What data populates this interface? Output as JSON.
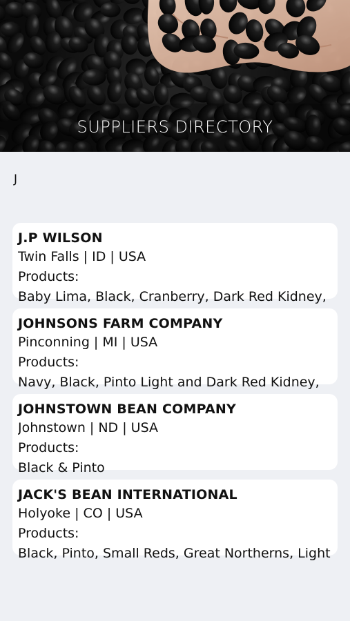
{
  "header": {
    "title": "SUPPLIERS DIRECTORY"
  },
  "filter_letter": "J",
  "suppliers": [
    {
      "name": "J.P WILSON",
      "location": "Twin Falls | ID | USA",
      "products_label": "Products:",
      "products": "Baby Lima, Black, Cranberry, Dark Red Kidney,"
    },
    {
      "name": "JOHNSONS FARM COMPANY",
      "location": "Pinconning | MI | USA",
      "products_label": "Products:",
      "products": "Navy, Black, Pinto Light and Dark Red Kidney,"
    },
    {
      "name": "JOHNSTOWN BEAN COMPANY",
      "location": "Johnstown | ND | USA",
      "products_label": "Products:",
      "products": "Black & Pinto"
    },
    {
      "name": "JACK'S BEAN INTERNATIONAL",
      "location": "Holyoke | CO | USA",
      "products_label": "Products:",
      "products": "Black, Pinto, Small Reds, Great Northerns, Light"
    }
  ]
}
